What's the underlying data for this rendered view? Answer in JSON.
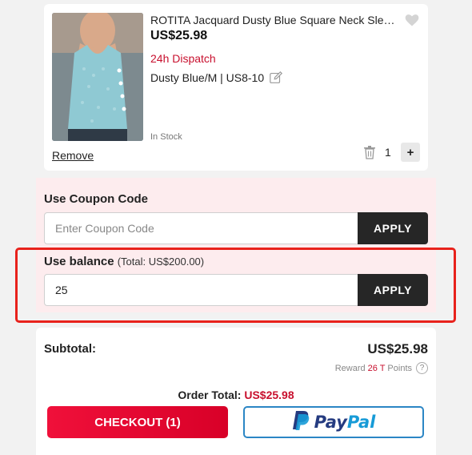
{
  "cart_item": {
    "title": "ROTITA Jacquard Dusty Blue Square Neck Sleeveless Tank Top",
    "price": "US$25.98",
    "dispatch": "24h Dispatch",
    "variant": "Dusty Blue/M | US8-10",
    "stock": "In Stock",
    "remove_label": "Remove",
    "quantity": "1",
    "plus_label": "+"
  },
  "coupon": {
    "label": "Use Coupon Code",
    "placeholder": "Enter Coupon Code",
    "apply_label": "APPLY"
  },
  "balance": {
    "label": "Use balance",
    "total_text": "(Total: US$200.00)",
    "value": "25",
    "apply_label": "APPLY"
  },
  "summary": {
    "subtotal_label": "Subtotal:",
    "subtotal_value": "US$25.98",
    "reward_prefix": "Reward",
    "reward_points": "26 T",
    "reward_suffix": "Points",
    "help_symbol": "?",
    "order_total_label": "Order Total:",
    "order_total_value": "US$25.98",
    "checkout_label": "CHECKOUT (1)",
    "paypal_pay": "Pay",
    "paypal_pal": "Pal"
  },
  "colors": {
    "accent_red": "#c8102e",
    "highlight_border": "#e8221c",
    "coupon_panel_bg": "#fdecee",
    "paypal_dark": "#253b80",
    "paypal_light": "#179bd7"
  },
  "icons": [
    "heart-icon",
    "edit-icon",
    "trash-icon",
    "plus-icon",
    "help-icon",
    "paypal-logo-icon"
  ]
}
